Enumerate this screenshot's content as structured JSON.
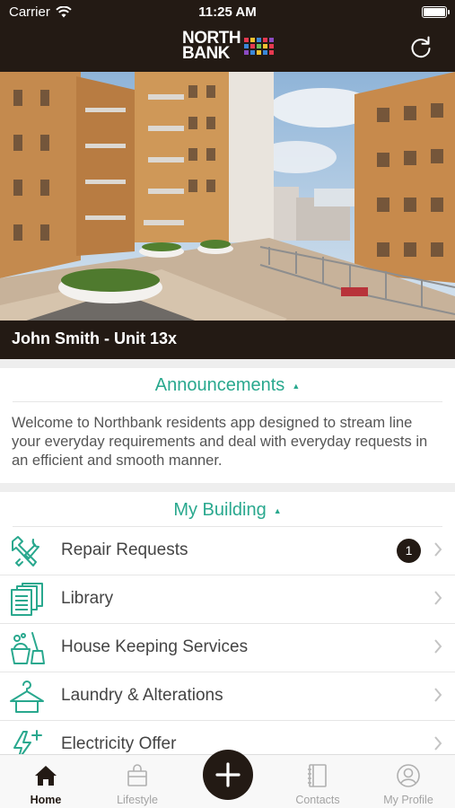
{
  "status_bar": {
    "carrier": "Carrier",
    "time": "11:25 AM"
  },
  "header": {
    "logo_line1": "NORTH",
    "logo_line2": "BANK",
    "logo_colors": [
      "#e63950",
      "#f2c230",
      "#3a87d8",
      "#e63950",
      "#8b4ac2",
      "#3a87d8",
      "#e63950",
      "#6bbf59",
      "#f2c230",
      "#e63950",
      "#8b4ac2",
      "#3a87d8",
      "#f2c230",
      "#3a87d8",
      "#e63950"
    ],
    "refresh_icon": "refresh-icon"
  },
  "hero": {
    "resident": "John Smith - Unit 13x"
  },
  "announcements": {
    "title": "Announcements",
    "arrow": "▲",
    "text": "Welcome to Northbank residents app designed to stream line your everyday requirements and deal with everyday requests in an efficient and smooth manner."
  },
  "my_building": {
    "title": "My Building",
    "arrow": "▲",
    "items": [
      {
        "label": "Repair Requests",
        "icon": "repair-tools-icon",
        "badge": "1"
      },
      {
        "label": "Library",
        "icon": "library-documents-icon"
      },
      {
        "label": "House Keeping Services",
        "icon": "cleaning-bucket-icon"
      },
      {
        "label": "Laundry & Alterations",
        "icon": "hanger-icon"
      },
      {
        "label": "Electricity Offer",
        "icon": "electricity-icon"
      }
    ]
  },
  "tabbar": {
    "tabs": [
      {
        "label": "Home",
        "icon": "home-icon",
        "active": true
      },
      {
        "label": "Lifestyle",
        "icon": "shopping-bag-icon"
      },
      {
        "label": "Contacts",
        "icon": "address-book-icon"
      },
      {
        "label": "My Profile",
        "icon": "profile-icon"
      }
    ],
    "fab_icon": "plus-icon"
  },
  "colors": {
    "dark": "#231a14",
    "accent": "#29a88e",
    "text": "#444444"
  }
}
